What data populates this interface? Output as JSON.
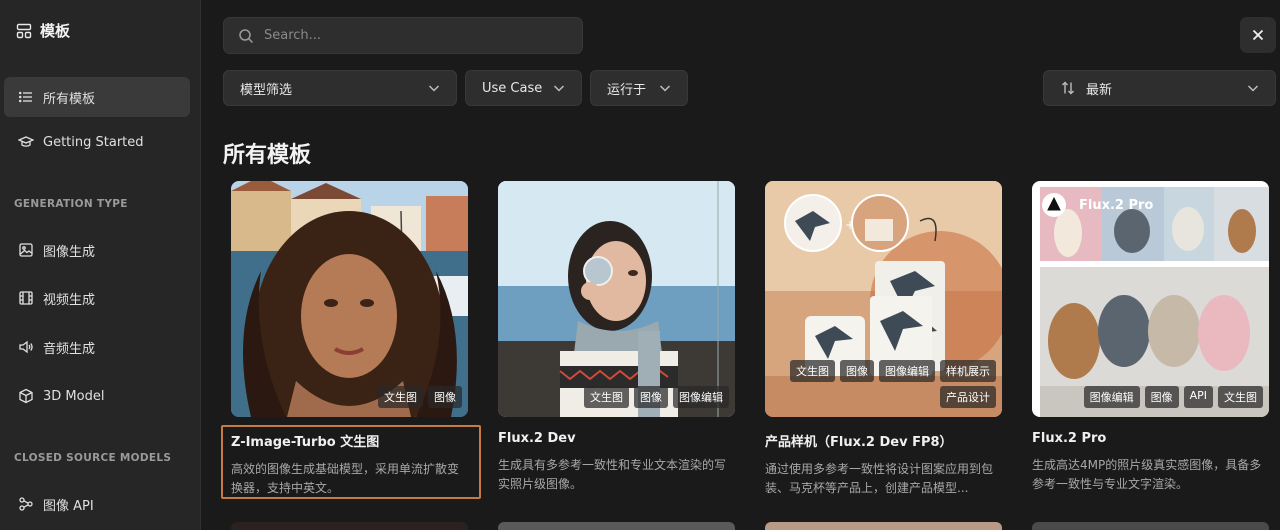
{
  "sidebar": {
    "title": "模板",
    "items_top": [
      {
        "label": "所有模板",
        "icon": "list-icon"
      },
      {
        "label": "Getting Started",
        "icon": "graduation-cap-icon"
      }
    ],
    "section_generation": "GENERATION TYPE",
    "generation_items": [
      {
        "label": "图像生成",
        "icon": "image-icon"
      },
      {
        "label": "视频生成",
        "icon": "film-icon"
      },
      {
        "label": "音频生成",
        "icon": "audio-icon"
      },
      {
        "label": "3D Model",
        "icon": "cube-icon"
      }
    ],
    "section_closed": "CLOSED SOURCE MODELS",
    "closed_items": [
      {
        "label": "图像 API",
        "icon": "image-api-icon"
      }
    ]
  },
  "search": {
    "placeholder": "Search..."
  },
  "filters": {
    "model": "模型筛选",
    "use_case": "Use Case",
    "runs_on": "运行于",
    "sort": "最新"
  },
  "heading": "所有模板",
  "cards": [
    {
      "title": "Z-Image-Turbo 文生图",
      "desc": "高效的图像生成基础模型，采用单流扩散变换器，支持中英文。",
      "tags": [
        "文生图",
        "图像"
      ]
    },
    {
      "title": "Flux.2 Dev",
      "desc": "生成具有多参考一致性和专业文本渲染的写实照片级图像。",
      "tags": [
        "文生图",
        "图像",
        "图像编辑"
      ]
    },
    {
      "title": "产品样机（Flux.2 Dev FP8）",
      "desc": "通过使用多参考一致性将设计图案应用到包装、马克杯等产品上，创建产品模型...",
      "tags_top": [
        "文生图",
        "图像",
        "图像编辑",
        "样机展示"
      ],
      "tags": [
        "产品设计"
      ]
    },
    {
      "title": "Flux.2 Pro",
      "desc": "生成高达4MP的照片级真实感图像，具备多参考一致性与专业文字渲染。",
      "tags": [
        "图像编辑",
        "图像",
        "API",
        "文生图"
      ],
      "overlay_label": "Flux.2 Pro"
    }
  ]
}
